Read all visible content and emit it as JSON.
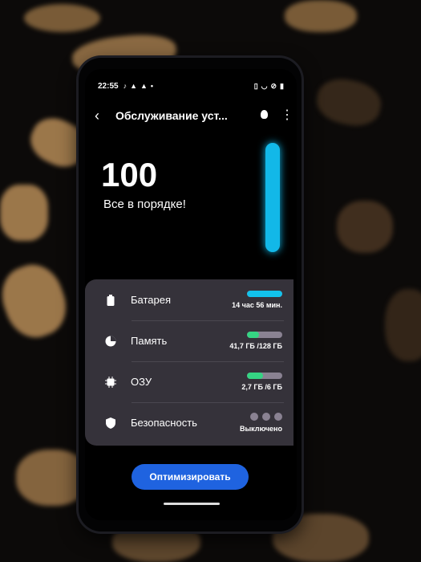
{
  "status_bar": {
    "time": "22:55"
  },
  "header": {
    "title": "Обслуживание уст..."
  },
  "score": {
    "value": "100",
    "message": "Все в порядке!",
    "gauge_level": 1.0
  },
  "items": [
    {
      "label": "Батарея",
      "value": "14 час 56 мин.",
      "level": 1.0,
      "bar_color": "#12c2ec"
    },
    {
      "label": "Память",
      "value": "41,7 ГБ /128 ГБ",
      "level": 0.33,
      "bar_color": "#35d483"
    },
    {
      "label": "ОЗУ",
      "value": "2,7 ГБ /6 ГБ",
      "level": 0.45,
      "bar_color": "#35d483"
    },
    {
      "label": "Безопасность",
      "value": "Выключено"
    }
  ],
  "optimize_button": {
    "label": "Оптимизировать"
  },
  "colors": {
    "accent": "#1f63e0",
    "gauge": "#12b8e8"
  }
}
